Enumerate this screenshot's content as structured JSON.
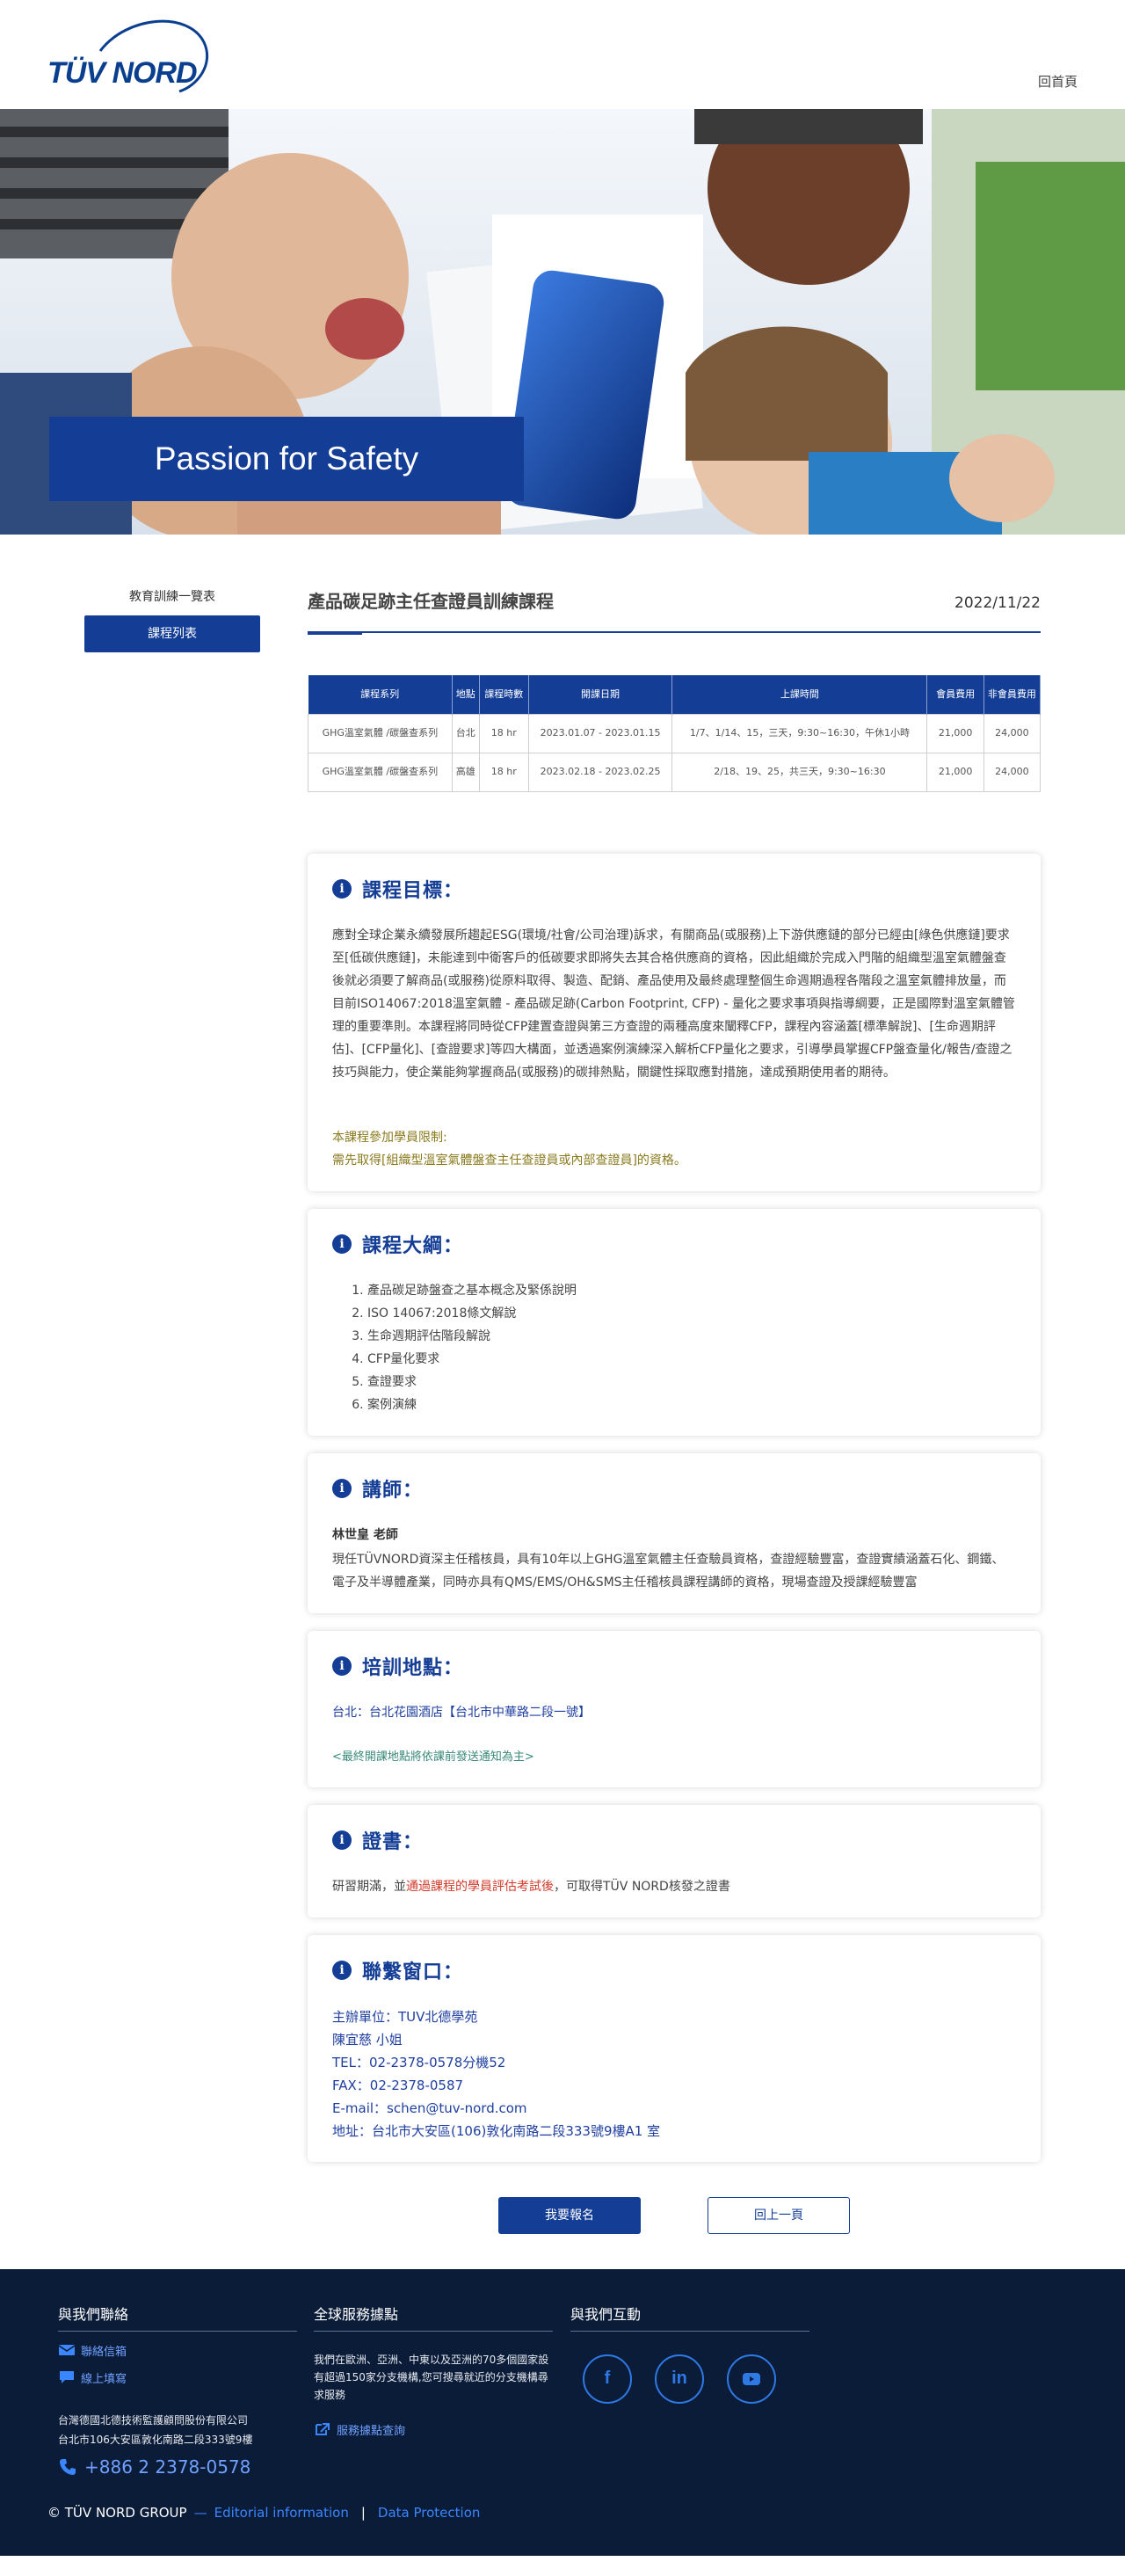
{
  "header": {
    "logo_text": "TÜV NORD",
    "home_link": "回首頁"
  },
  "hero": {
    "banner_text": "Passion for Safety"
  },
  "sidebar": {
    "title": "教育訓練一覽表",
    "button": "課程列表"
  },
  "page": {
    "title": "產品碳足跡主任查證員訓練課程",
    "date": "2022/11/22"
  },
  "table": {
    "headers": [
      "課程系列",
      "地點",
      "課程時數",
      "開課日期",
      "上課時間",
      "會員費用",
      "非會員費用"
    ],
    "rows": [
      [
        "GHG溫室氣體 /碳盤查系列",
        "台北",
        "18 hr",
        "2023.01.07 - 2023.01.15",
        "1/7、1/14、15，三天，9:30~16:30，午休1小時",
        "21,000",
        "24,000"
      ],
      [
        "GHG溫室氣體 /碳盤查系列",
        "高雄",
        "18 hr",
        "2023.02.18 - 2023.02.25",
        "2/18、19、25，共三天，9:30~16:30",
        "21,000",
        "24,000"
      ]
    ]
  },
  "goal": {
    "title": "課程目標：",
    "body": "應對全球企業永續發展所趨起ESG(環境/社會/公司治理)訴求，有關商品(或服務)上下游供應鏈的部分已經由[綠色供應鏈]要求至[低碳供應鏈]，未能達到中衛客戶的低碳要求即將失去其合格供應商的資格，因此組織於完成入門階的組織型溫室氣體盤查後就必須要了解商品(或服務)從原料取得、製造、配銷、產品使用及最終處理整個生命週期過程各階段之溫室氣體排放量，而目前ISO14067:2018溫室氣體 - 產品碳足跡(Carbon Footprint, CFP) - 量化之要求事項與指導綱要，正是國際對溫室氣體管理的重要準則。本課程將同時從CFP建置查證與第三方查證的兩種高度來闡釋CFP，課程內容涵蓋[標準解說]、[生命週期評估]、[CFP量化]、[查證要求]等四大構面，並透過案例演練深入解析CFP量化之要求，引導學員掌握CFP盤查量化/報告/查證之技巧與能力，使企業能夠掌握商品(或服務)的碳排熱點，關鍵性採取應對措施，達成預期使用者的期待。",
    "restrict_title": "本課程參加學員限制:",
    "restrict_body": "需先取得[組織型溫室氣體盤查主任查證員或內部查證員]的資格。"
  },
  "outline": {
    "title": "課程大綱：",
    "items": [
      "產品碳足跡盤查之基本概念及緊係說明",
      "ISO 14067:2018條文解說",
      "生命週期評估階段解說",
      "CFP量化要求",
      "查證要求",
      "案例演練"
    ]
  },
  "lecturer": {
    "title": "講師：",
    "name": "林世皇 老師",
    "bio": "現任TÜVNORD資深主任稽核員，具有10年以上GHG溫室氣體主任查驗員資格，查證經驗豐富，查證實績涵蓋石化、鋼鐵、電子及半導體產業，同時亦具有QMS/EMS/OH&SMS主任稽核員課程講師的資格，現場查證及授課經驗豐富"
  },
  "location": {
    "title": "培訓地點：",
    "place": "台北：台北花園酒店【台北市中華路二段一號】",
    "note": "<最終開課地點將依課前發送通知為主>"
  },
  "certificate": {
    "title": "證書：",
    "before": "研習期滿，並",
    "highlight": "通過課程的學員評估考試後",
    "after": "，可取得TÜV NORD核發之證書"
  },
  "contact": {
    "title": "聯繫窗口：",
    "lines": [
      "主辦單位：TUV北德學苑",
      "陳宜慈 小姐",
      "TEL：02-2378-0578分機52",
      "FAX：02-2378-0587",
      "E-mail：schen@tuv-nord.com",
      "地址：台北市大安區(106)敦化南路二段333號9樓A1 室"
    ]
  },
  "actions": {
    "signup": "我要報名",
    "back": "回上一頁"
  },
  "footer": {
    "col1_title": "與我們聯絡",
    "contact_link": "聯絡信箱",
    "online_link": "線上填寫",
    "company": "台灣德國北德技術監護顧問股份有限公司",
    "address": "台北市106大安區敦化南路二段333號9樓",
    "phone": "+886 2 2378-0578",
    "col2_title": "全球服務據點",
    "col2_text": "我們在歐洲、亞洲、中東以及亞洲的70多個國家設有超過150家分支機構,您可搜尋就近的分支機構尋求服務",
    "service_link": "服務據點查詢",
    "col3_title": "與我們互動",
    "copyright": "© TÜV NORD GROUP",
    "editorial": "Editorial information",
    "privacy": "Data Protection"
  },
  "colors": {
    "brand_blue": "#143d96",
    "footer_bg": "#0b1c38",
    "link_blue": "#1f3fa0",
    "highlight_red": "#d23a2a"
  }
}
